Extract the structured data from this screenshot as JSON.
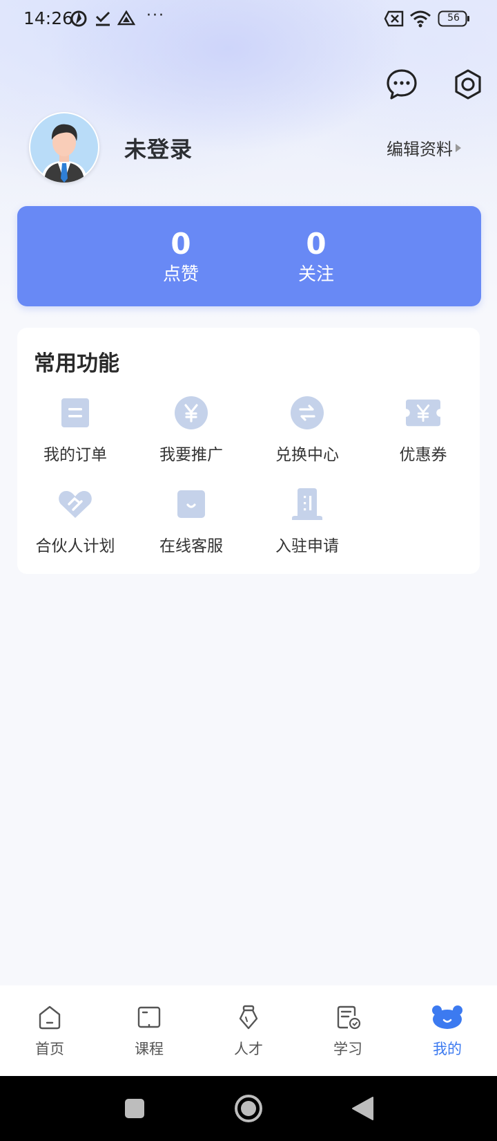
{
  "status_bar": {
    "time": "14:26",
    "battery": "56",
    "icons": [
      "aperture-icon",
      "download-check-icon",
      "drive-icon",
      "more-dots-icon",
      "no-sim-icon",
      "wifi-icon",
      "battery-icon"
    ],
    "overflow": "···"
  },
  "header": {
    "icons": [
      "message-icon",
      "settings-icon"
    ]
  },
  "profile": {
    "username": "未登录",
    "edit_label": "编辑资料"
  },
  "stats": {
    "likes_value": "0",
    "likes_label": "点赞",
    "follow_value": "0",
    "follow_label": "关注"
  },
  "features": {
    "title": "常用功能",
    "items": [
      {
        "label": "我的订单",
        "icon": "order-icon"
      },
      {
        "label": "我要推广",
        "icon": "promote-yuan-icon"
      },
      {
        "label": "兑换中心",
        "icon": "exchange-icon"
      },
      {
        "label": "优惠券",
        "icon": "coupon-icon"
      },
      {
        "label": "合伙人计划",
        "icon": "handshake-icon"
      },
      {
        "label": "在线客服",
        "icon": "support-icon"
      },
      {
        "label": "入驻申请",
        "icon": "building-icon"
      }
    ]
  },
  "tabs": [
    {
      "label": "首页",
      "icon": "home-icon"
    },
    {
      "label": "课程",
      "icon": "book-icon"
    },
    {
      "label": "人才",
      "icon": "talent-icon"
    },
    {
      "label": "学习",
      "icon": "study-icon"
    },
    {
      "label": "我的",
      "icon": "mine-icon",
      "active": true
    }
  ],
  "colors": {
    "accent": "#6889f5",
    "tab_active": "#3c7af0",
    "icon_tint": "#c5d2ea",
    "nav_bar": "#000000"
  }
}
